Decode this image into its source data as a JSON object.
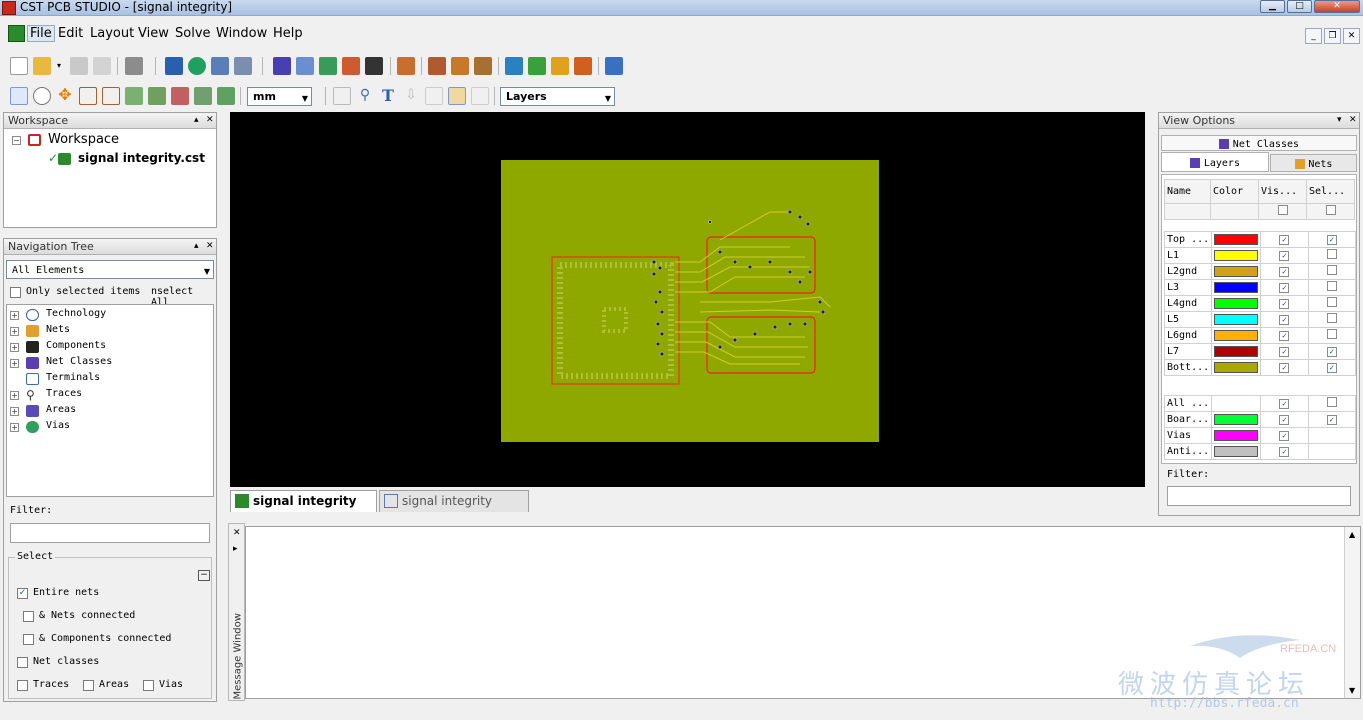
{
  "window": {
    "title": "CST PCB STUDIO - [signal integrity]"
  },
  "menubar": {
    "items": [
      "File",
      "Edit",
      "Layout",
      "View",
      "Solve",
      "Window",
      "Help"
    ]
  },
  "toolbar": {
    "units_value": "mm",
    "view_value": "Layers"
  },
  "workspace_panel": {
    "title": "Workspace",
    "root": "Workspace",
    "file": "signal integrity.cst"
  },
  "nav_panel": {
    "title": "Navigation Tree",
    "filter_select": "All Elements",
    "only_selected": "Only selected items",
    "unselect_all": "nselect All",
    "items": [
      "Technology",
      "Nets",
      "Components",
      "Net Classes",
      "Terminals",
      "Traces",
      "Areas",
      "Vias"
    ],
    "filter_label": "Filter:",
    "select_group": "Select",
    "options": {
      "entire_nets": "Entire nets",
      "nets_connected": "& Nets connected",
      "components_connected": "& Components connected",
      "net_classes": "Net classes",
      "traces": "Traces",
      "areas": "Areas",
      "vias": "Vias"
    }
  },
  "doc_tabs": {
    "active": "signal integrity",
    "inactive": "signal integrity"
  },
  "message_window": {
    "label": "Message Window"
  },
  "view_options": {
    "title": "View Options",
    "tab_net_classes": "Net Classes",
    "tab_layers": "Layers",
    "tab_nets": "Nets",
    "columns": [
      "Name",
      "Color",
      "Vis...",
      "Sel..."
    ],
    "layers": [
      {
        "name": "Top ...",
        "color": "#ff0000",
        "vis": true,
        "sel": true
      },
      {
        "name": "L1",
        "color": "#ffff00",
        "vis": true,
        "sel": false
      },
      {
        "name": "L2gnd",
        "color": "#d4a017",
        "vis": true,
        "sel": false
      },
      {
        "name": "L3",
        "color": "#0000ff",
        "vis": true,
        "sel": false
      },
      {
        "name": "L4gnd",
        "color": "#00ff00",
        "vis": true,
        "sel": false
      },
      {
        "name": "L5",
        "color": "#00ffff",
        "vis": true,
        "sel": false
      },
      {
        "name": "L6gnd",
        "color": "#ffb000",
        "vis": true,
        "sel": false
      },
      {
        "name": "L7",
        "color": "#b00000",
        "vis": true,
        "sel": true
      },
      {
        "name": "Bott...",
        "color": "#a8a800",
        "vis": true,
        "sel": true
      }
    ],
    "others": [
      {
        "name": "All ...",
        "color": "",
        "vis": true,
        "sel": false
      },
      {
        "name": "Boar...",
        "color": "#00ff33",
        "vis": true,
        "sel": true
      },
      {
        "name": "Vias",
        "color": "#ff00ff",
        "vis": true,
        "sel": null
      },
      {
        "name": "Anti...",
        "color": "#c0c0c0",
        "vis": true,
        "sel": null
      }
    ],
    "filter_label": "Filter:"
  },
  "watermark": {
    "line1": "微波仿真论坛",
    "site": "RFEDA.CN",
    "url": "http://bbs.rfeda.cn"
  },
  "colors": {
    "board": "#8fa800",
    "viewport_bg": "#000000",
    "outline": "#ff1a1a"
  }
}
